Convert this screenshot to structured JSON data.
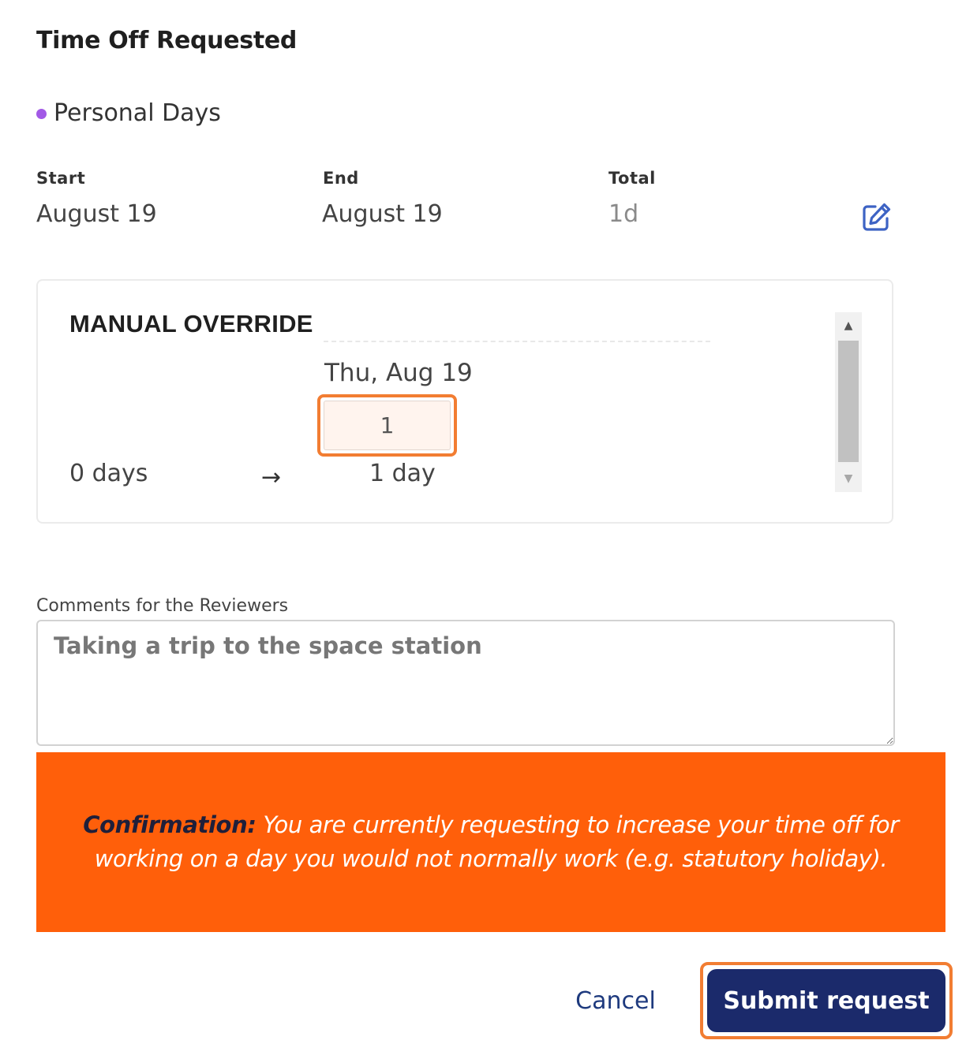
{
  "header": {
    "title": "Time Off Requested"
  },
  "policy": {
    "name": "Personal Days",
    "color": "#a259e6"
  },
  "summary": {
    "start_label": "Start",
    "start_value": "August 19",
    "end_label": "End",
    "end_value": "August 19",
    "total_label": "Total",
    "total_value": "1d"
  },
  "override": {
    "title": "MANUAL OVERRIDE",
    "day_label": "Thu, Aug 19",
    "day_value": "1",
    "from_text": "0 days",
    "arrow": "→",
    "to_text": "1 day"
  },
  "comments": {
    "label": "Comments for the Reviewers",
    "value": "Taking a trip to the space station"
  },
  "confirmation": {
    "lead": "Confirmation:",
    "message": " You are currently requesting to increase your time off for working on a day you would not normally work (e.g. statutory holiday)."
  },
  "actions": {
    "cancel_label": "Cancel",
    "submit_label": "Submit request"
  },
  "colors": {
    "accent": "#ff5f0a",
    "primary": "#1b2a6b",
    "highlight": "#f27d32",
    "link": "#1e3a7e",
    "icon": "#3d63c4"
  }
}
